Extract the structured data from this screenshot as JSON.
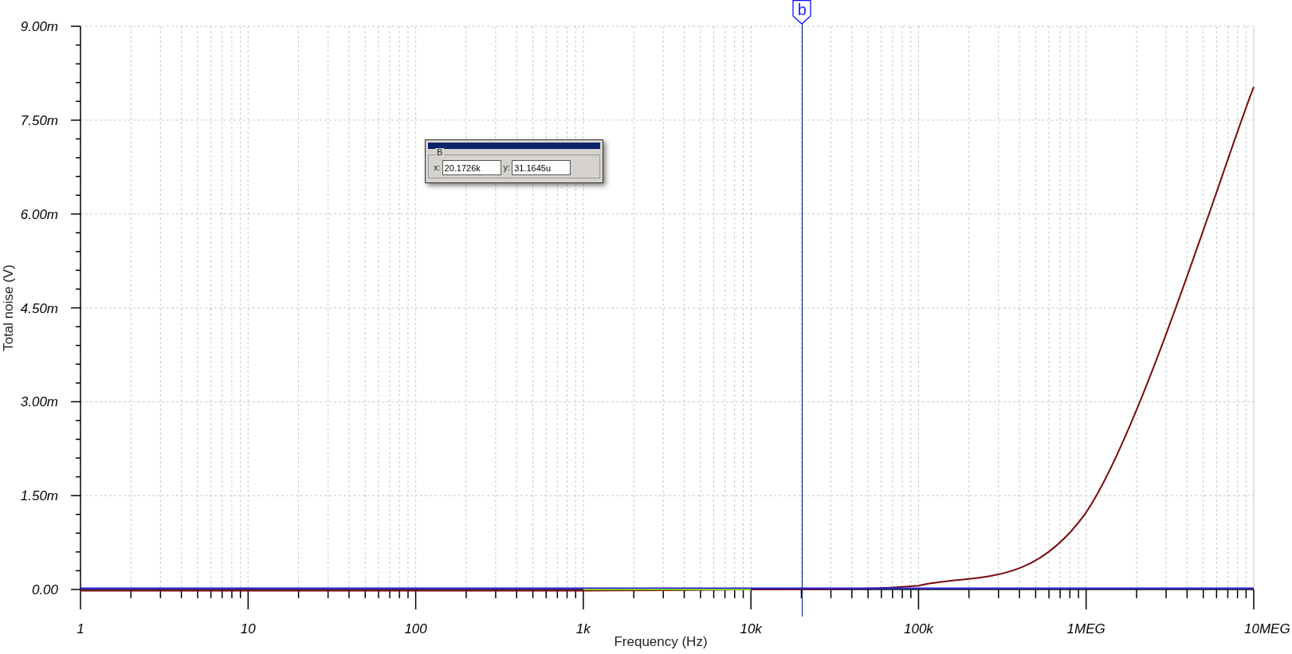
{
  "plot": {
    "chart_data": {
      "type": "line",
      "xlabel": "Frequency (Hz)",
      "ylabel": "Total noise (V)",
      "categories": [
        "1",
        "10",
        "100",
        "1k",
        "10k",
        "100k",
        "1MEG",
        "10MEG"
      ],
      "series": [
        {
          "color": "#7a0a0a",
          "values": [
            0,
            0,
            0,
            0,
            0.02,
            0.08,
            1.25,
            8.05
          ]
        },
        {
          "color": "#2020e0",
          "values": [
            0,
            0,
            0,
            0,
            0,
            0,
            0,
            0
          ]
        },
        {
          "color": "#88cc22",
          "values": [
            null,
            null,
            null,
            0,
            0,
            null,
            null,
            null
          ]
        }
      ],
      "ylim": [
        0,
        9
      ],
      "grid": true,
      "yticks": [
        {
          "value": 0,
          "label": "0.00"
        },
        {
          "value": 1.5,
          "label": "1.50m"
        },
        {
          "value": 3,
          "label": "3.00m"
        },
        {
          "value": 4.5,
          "label": "4.50m"
        },
        {
          "value": 6,
          "label": "6.00m"
        },
        {
          "value": 7.5,
          "label": "7.50m"
        },
        {
          "value": 9,
          "label": "9.00m"
        }
      ]
    },
    "cursor": {
      "marker": "b"
    },
    "cursor_panel": {
      "title": "B",
      "x_label": "x:",
      "x_value": "20.1726k",
      "y_label": "y:",
      "y_value": "31.1645u"
    }
  }
}
